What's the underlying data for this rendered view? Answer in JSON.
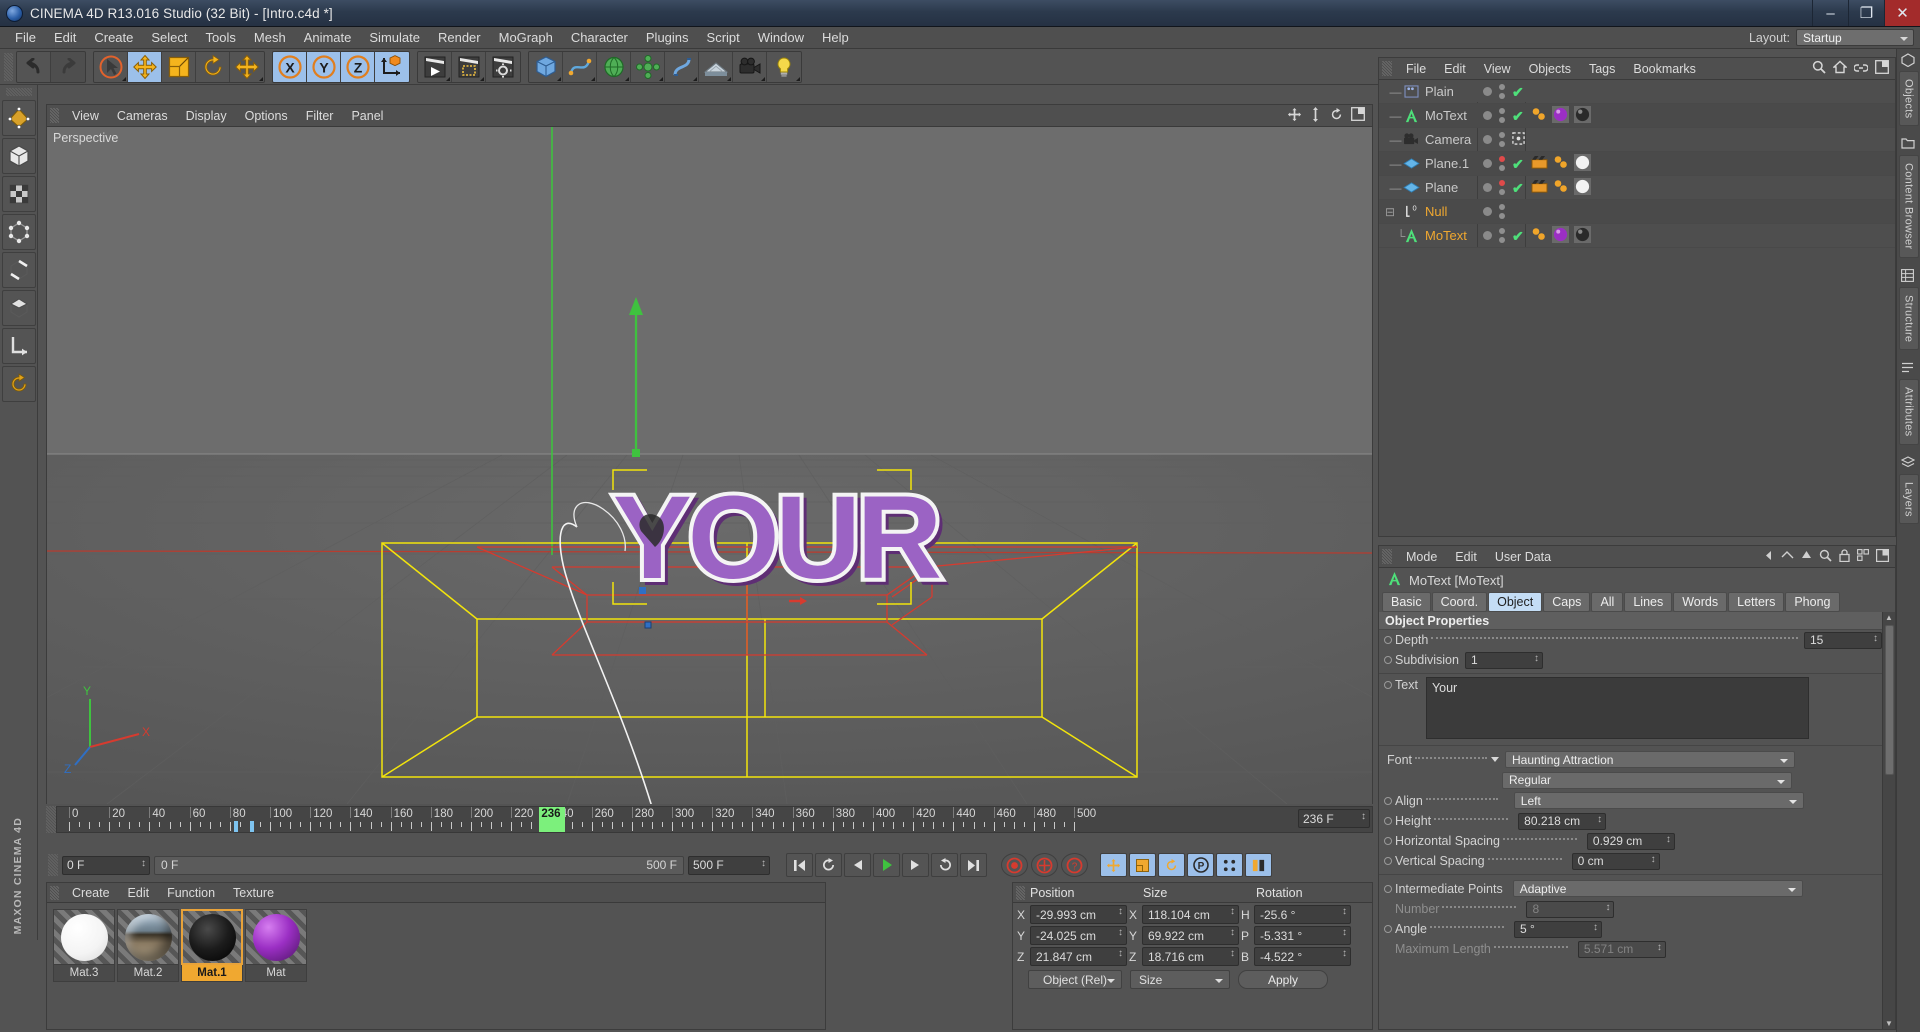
{
  "window": {
    "title": "CINEMA 4D R13.016 Studio (32 Bit) - [Intro.c4d *]",
    "minimize": "–",
    "maximize": "❐",
    "close": "✕"
  },
  "menubar": {
    "items": [
      "File",
      "Edit",
      "Create",
      "Select",
      "Tools",
      "Mesh",
      "Animate",
      "Simulate",
      "Render",
      "MoGraph",
      "Character",
      "Plugins",
      "Script",
      "Window",
      "Help"
    ],
    "layout_label": "Layout:",
    "layout_value": "Startup"
  },
  "toolbar": {
    "groups": [
      {
        "name": "undo-redo",
        "buttons": [
          {
            "name": "undo",
            "glyph": "undo",
            "state": "normal"
          },
          {
            "name": "redo",
            "glyph": "redo",
            "state": "dim"
          }
        ]
      },
      {
        "name": "transform-tools",
        "buttons": [
          {
            "name": "live-selection",
            "glyph": "cursor",
            "state": "normal"
          },
          {
            "name": "move",
            "glyph": "move",
            "state": "selected"
          },
          {
            "name": "scale",
            "glyph": "scale",
            "state": "normal"
          },
          {
            "name": "rotate",
            "glyph": "rotate",
            "state": "normal"
          },
          {
            "name": "transform-extra",
            "glyph": "move",
            "state": "normal"
          }
        ]
      },
      {
        "name": "axis-locks",
        "buttons": [
          {
            "name": "x-axis",
            "glyph": "X",
            "state": "selected"
          },
          {
            "name": "y-axis",
            "glyph": "Y",
            "state": "selected"
          },
          {
            "name": "z-axis",
            "glyph": "Z",
            "state": "selected"
          },
          {
            "name": "world-object-axis",
            "glyph": "axis-cube",
            "state": "normal"
          }
        ]
      },
      {
        "name": "render-tools",
        "buttons": [
          {
            "name": "render-view",
            "glyph": "render-view",
            "state": "normal"
          },
          {
            "name": "render-region",
            "glyph": "render-region",
            "state": "normal"
          },
          {
            "name": "render-settings",
            "glyph": "render-settings",
            "state": "normal"
          }
        ]
      },
      {
        "name": "primitives",
        "buttons": [
          {
            "name": "add-cube",
            "glyph": "cube",
            "state": "normal"
          },
          {
            "name": "add-spline",
            "glyph": "spline",
            "state": "normal"
          },
          {
            "name": "add-nurbs",
            "glyph": "nurbs",
            "state": "normal"
          },
          {
            "name": "add-modelling-object",
            "glyph": "array",
            "state": "normal"
          },
          {
            "name": "add-deformer",
            "glyph": "deformer",
            "state": "normal"
          },
          {
            "name": "add-scene-object",
            "glyph": "floor",
            "state": "normal"
          },
          {
            "name": "add-camera",
            "glyph": "camera",
            "state": "normal"
          },
          {
            "name": "add-light",
            "glyph": "light",
            "state": "normal"
          }
        ]
      }
    ]
  },
  "left_toolbar": {
    "items": [
      {
        "name": "make-editable",
        "glyph": "editable"
      },
      {
        "name": "model-mode",
        "glyph": "model"
      },
      {
        "name": "texture-mode",
        "glyph": "texture"
      },
      {
        "name": "points-mode",
        "glyph": "points"
      },
      {
        "name": "edges-mode",
        "glyph": "edges"
      },
      {
        "name": "polygons-mode",
        "glyph": "polygons"
      },
      {
        "name": "axis-mode",
        "glyph": "axis"
      },
      {
        "name": "enable-axis",
        "glyph": "enable-axis"
      }
    ],
    "brand": "MAXON CINEMA 4D"
  },
  "viewport": {
    "menu": [
      "View",
      "Cameras",
      "Display",
      "Options",
      "Filter",
      "Panel"
    ],
    "label": "Perspective",
    "nav_icons": [
      "pan-icon",
      "dolly-icon",
      "orbit-icon",
      "maximize-view-icon"
    ],
    "axis_x": "X",
    "axis_y": "Y",
    "axis_z": "Z",
    "text_object": "YOUR"
  },
  "timeline": {
    "ticks": [
      0,
      20,
      40,
      60,
      80,
      100,
      120,
      140,
      160,
      180,
      200,
      220,
      240,
      260,
      280,
      300,
      320,
      340,
      360,
      380,
      400,
      420,
      440,
      460,
      480,
      500
    ],
    "current_frame": "236",
    "current_frame_field": "236 F",
    "start_field": "0 F",
    "range_start": "0 F",
    "range_end": "500 F",
    "end_field": "500 F"
  },
  "transport": {
    "buttons": [
      {
        "name": "go-to-start",
        "glyph": "⏮",
        "state": "normal"
      },
      {
        "name": "previous-key",
        "glyph": "↻",
        "state": "normal"
      },
      {
        "name": "previous-frame",
        "glyph": "◀",
        "state": "normal"
      },
      {
        "name": "play-forwards",
        "glyph": "▶",
        "state": "play"
      },
      {
        "name": "next-frame",
        "glyph": "▶",
        "state": "normal"
      },
      {
        "name": "next-key",
        "glyph": "↺",
        "state": "normal"
      },
      {
        "name": "go-to-end",
        "glyph": "⏭",
        "state": "normal"
      }
    ],
    "record_buttons": [
      {
        "name": "record-active-objects",
        "glyph": "record"
      },
      {
        "name": "autokeying",
        "glyph": "autokey"
      },
      {
        "name": "keyframe-selection",
        "glyph": "keysel"
      }
    ],
    "key_buttons": [
      {
        "name": "position-key",
        "glyph": "pos",
        "state": "on"
      },
      {
        "name": "scale-key",
        "glyph": "scale",
        "state": "on"
      },
      {
        "name": "rotation-key",
        "glyph": "rot",
        "state": "on"
      },
      {
        "name": "parameter-key",
        "glyph": "P",
        "state": "on"
      },
      {
        "name": "pla-key",
        "glyph": "pla",
        "state": "on"
      },
      {
        "name": "animation-layer",
        "glyph": "layer",
        "state": "on"
      }
    ]
  },
  "material_manager": {
    "menu": [
      "Create",
      "Edit",
      "Function",
      "Texture"
    ],
    "materials": [
      {
        "name": "Mat.3",
        "color": "#f2f2f2",
        "type": "white",
        "selected": false
      },
      {
        "name": "Mat.2",
        "color": "#8d8f84",
        "type": "chrome",
        "selected": false
      },
      {
        "name": "Mat.1",
        "color": "#151515",
        "type": "black",
        "selected": true
      },
      {
        "name": "Mat",
        "color": "#9b2fc4",
        "type": "purple",
        "selected": false
      }
    ]
  },
  "coordinates": {
    "columns": [
      "Position",
      "Size",
      "Rotation"
    ],
    "rows": [
      {
        "axis_pos": "X",
        "position": "-29.993 cm",
        "axis_size": "X",
        "size": "118.104 cm",
        "axis_rot": "H",
        "rotation": "-25.6 °"
      },
      {
        "axis_pos": "Y",
        "position": "-24.025 cm",
        "axis_size": "Y",
        "size": "69.922 cm",
        "axis_rot": "P",
        "rotation": "-5.331 °"
      },
      {
        "axis_pos": "Z",
        "position": "21.847 cm",
        "axis_size": "Z",
        "size": "18.716 cm",
        "axis_rot": "B",
        "rotation": "-4.522 °"
      }
    ],
    "mode_dropdown": "Object (Rel)",
    "size_dropdown": "Size",
    "apply_button": "Apply"
  },
  "object_manager": {
    "menu": [
      "File",
      "Edit",
      "View",
      "Objects",
      "Tags",
      "Bookmarks"
    ],
    "header_icons": [
      "search-icon",
      "home-icon",
      "link-icon",
      "layout-icon"
    ],
    "objects": [
      {
        "name": "Plain",
        "icon": "plain-effector-icon",
        "indent": 1,
        "selected": false,
        "visdot": true,
        "dots": "normal",
        "check": true,
        "tags": []
      },
      {
        "name": "MoText",
        "icon": "motext-icon",
        "indent": 1,
        "selected": false,
        "visdot": true,
        "dots": "normal",
        "check": true,
        "tags": [
          "material-orange",
          "material-purple",
          "material-chrome"
        ]
      },
      {
        "name": "Camera",
        "icon": "camera-icon",
        "indent": 1,
        "selected": false,
        "visdot": true,
        "dots": "normal",
        "check": false,
        "target": true,
        "tags": []
      },
      {
        "name": "Plane.1",
        "icon": "plane-icon",
        "indent": 1,
        "selected": false,
        "visdot": true,
        "dots": "red",
        "check": true,
        "tags": [
          "tag-film",
          "material-orange",
          "material-white"
        ]
      },
      {
        "name": "Plane",
        "icon": "plane-icon",
        "indent": 1,
        "selected": false,
        "visdot": true,
        "dots": "red",
        "check": true,
        "tags": [
          "tag-film",
          "material-orange",
          "material-white"
        ]
      },
      {
        "name": "Null",
        "icon": "null-icon",
        "indent": 0,
        "selected": true,
        "visdot": true,
        "dots": "normal",
        "check": false,
        "expandable": true,
        "tags": []
      },
      {
        "name": "MoText",
        "icon": "motext-icon",
        "indent": 2,
        "selected": true,
        "visdot": true,
        "dots": "normal",
        "check": true,
        "tags": [
          "material-orange",
          "material-purple",
          "material-chrome"
        ]
      }
    ]
  },
  "attribute_manager": {
    "menu": [
      "Mode",
      "Edit",
      "User Data"
    ],
    "header_icons": [
      "prev-icon",
      "pin-icon",
      "up-icon",
      "search-icon",
      "lock-icon",
      "grid-icon",
      "layout-icon"
    ],
    "object_title": "MoText [MoText]",
    "tabs": [
      {
        "label": "Basic",
        "active": false
      },
      {
        "label": "Coord.",
        "active": false
      },
      {
        "label": "Object",
        "active": true
      },
      {
        "label": "Caps",
        "active": false
      },
      {
        "label": "All",
        "active": false
      },
      {
        "label": "Lines",
        "active": false
      },
      {
        "label": "Words",
        "active": false
      },
      {
        "label": "Letters",
        "active": false
      },
      {
        "label": "Phong",
        "active": false
      }
    ],
    "section_title": "Object Properties",
    "properties": [
      {
        "label": "Depth",
        "value": "15",
        "kind": "spin",
        "dots": true,
        "radio": true,
        "disabled": false
      },
      {
        "label": "Subdivision",
        "value": "1",
        "kind": "spin",
        "dots": false,
        "radio": true,
        "disabled": false
      }
    ],
    "text_label": "Text",
    "text_value": "Your",
    "font_label": "Font",
    "font_value": "Haunting Attraction",
    "font_style_value": "Regular",
    "align_label": "Align",
    "align_value": "Left",
    "fields": [
      {
        "label": "Height",
        "value": "80.218 cm",
        "disabled": false
      },
      {
        "label": "Horizontal Spacing",
        "value": "0.929 cm",
        "disabled": false
      },
      {
        "label": "Vertical Spacing",
        "value": "0 cm",
        "disabled": false
      }
    ],
    "intermediate_points_label": "Intermediate Points",
    "intermediate_points_value": "Adaptive",
    "fields2": [
      {
        "label": "Number",
        "value": "8",
        "disabled": true
      },
      {
        "label": "Angle",
        "value": "5 °",
        "disabled": false
      },
      {
        "label": "Maximum Length",
        "value": "5.571 cm",
        "disabled": true
      }
    ]
  },
  "right_tabs": [
    {
      "label": "Objects",
      "name": "objects-tab"
    },
    {
      "label": "Content Browser",
      "name": "content-browser-tab"
    },
    {
      "label": "Structure",
      "name": "structure-tab"
    },
    {
      "label": "Attributes",
      "name": "attributes-tab"
    },
    {
      "label": "Layers",
      "name": "layers-tab"
    }
  ],
  "colors": {
    "accent_orange": "#f0a830",
    "accent_blue": "#9cc0ea",
    "green_check": "#4ee07a",
    "panel_bg": "#535353",
    "title_bg": "#2c3a4d"
  }
}
